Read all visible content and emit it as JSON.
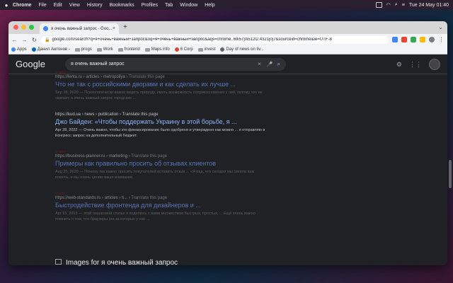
{
  "menubar": {
    "apple": "",
    "items": [
      "Chrome",
      "File",
      "Edit",
      "View",
      "History",
      "Bookmarks",
      "Profiles",
      "Tab",
      "Window",
      "Help"
    ],
    "datetime": "Tue 24 May  01:40"
  },
  "tab": {
    "title": "я очень важный запрос - Goo...",
    "close": "×"
  },
  "newtab": "+",
  "toolbar": {
    "back": "←",
    "forward": "→",
    "reload": "↻",
    "url": "google.com/search?q=я+очень+важный+запрос&oq=я+очень+важный+запрос&aqs=chrome..69i57j0i512l2.4321j0j7&sourceid=chrome&ie=UTF-8"
  },
  "bookmarks": [
    "Apps",
    "Данил Антонов -",
    "progs",
    "Work",
    "frontend",
    "Maps info",
    "6 Corp",
    "invest",
    "Day of news on liv..."
  ],
  "google": {
    "logo": "Google",
    "query": "я очень важный запрос",
    "clear": "×",
    "mic": "🎤",
    "search": "⌕"
  },
  "results": [
    {
      "ad": "ry adw",
      "cite": "https://lenta.ru › articles › metropoliya",
      "translate": "Translate this page",
      "title": "Что не так с российскими дворами и как сделать их лучше ...",
      "snippet": "Sep 28, 2020 — Психологически важно видеть природу, иметь возможность соприкосновения с ней, потому что не хватает, а очень важный запрос городских ...",
      "bright": false
    },
    {
      "ad": "",
      "cite": "https://kud.ua › news › publication",
      "translate": "Translate this page",
      "title": "Джо Байден: «Чтобы поддержать Украину в этой борьбе, я ...",
      "snippet": "Apr 28, 2022 — Очень важно, чтобы это финансирование было одобрено и утверждено как можно ... я отправляю в Конгресс запрос на дополнительный бюджет.",
      "bright": true
    },
    {
      "ad": "ry adw",
      "cite": "https://business-planner.ru › marketing",
      "translate": "Translate this page",
      "title": "Примеры как правильно просить об отзывах клиентов",
      "snippet": "Aug 25, 2020 — Почему так важно просить покупателей оставить отзыв ... «Я рад, что сегодня мы смогли вам помочь, и мы очень ценим ваше внимание.",
      "bright": false
    },
    {
      "ad": "ry adw",
      "cite": "https://web-standards.ru › articles › ti...",
      "translate": "Translate this page",
      "title": "Быстродействие фронтенда для дизайнеров и ...",
      "snippet": "Apr 15, 2013 — этой пошаговой статье я поделюсь с вами множеством быстрых, простых, ... Ещё очень важно помнить о том, что браузеры (из-за которых у нас ...",
      "bright": false
    }
  ],
  "images_heading": "Images for я очень важный запрос",
  "colors": {
    "accent": "#8ab4f8",
    "bg": "#202124"
  }
}
